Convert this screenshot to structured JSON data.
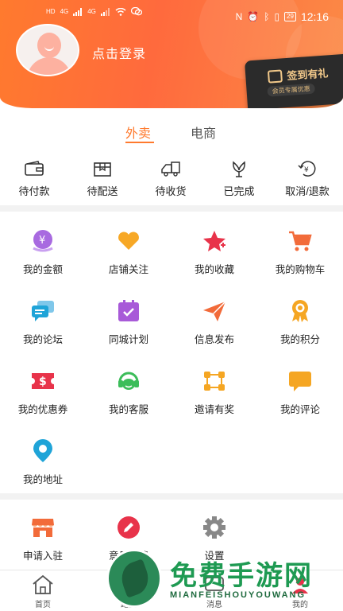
{
  "status_bar": {
    "left_indicators": [
      "HD",
      "4G",
      "4G"
    ],
    "time": "12:16",
    "battery": "29"
  },
  "header": {
    "login_text": "点击登录",
    "signin_label": "签到有礼",
    "signin_sub": "会员专属优惠"
  },
  "tabs": [
    {
      "label": "外卖",
      "active": true
    },
    {
      "label": "电商",
      "active": false
    }
  ],
  "orders": [
    {
      "label": "待付款",
      "icon": "wallet-icon"
    },
    {
      "label": "待配送",
      "icon": "package-icon"
    },
    {
      "label": "待收货",
      "icon": "truck-icon"
    },
    {
      "label": "已完成",
      "icon": "flower-icon"
    },
    {
      "label": "取消/退款",
      "icon": "refund-icon"
    }
  ],
  "services": [
    {
      "label": "我的金额",
      "icon": "money-icon",
      "color": "#9b59d6"
    },
    {
      "label": "店铺关注",
      "icon": "heart-icon",
      "color": "#f5a623"
    },
    {
      "label": "我的收藏",
      "icon": "star-icon",
      "color": "#e8334a"
    },
    {
      "label": "我的购物车",
      "icon": "cart-icon",
      "color": "#f26b3a"
    },
    {
      "label": "我的论坛",
      "icon": "forum-icon",
      "color": "#1fa4d8"
    },
    {
      "label": "同城计划",
      "icon": "calendar-icon",
      "color": "#a85ad8"
    },
    {
      "label": "信息发布",
      "icon": "send-icon",
      "color": "#f26b3a"
    },
    {
      "label": "我的积分",
      "icon": "medal-icon",
      "color": "#f5a623"
    },
    {
      "label": "我的优惠券",
      "icon": "coupon-icon",
      "color": "#e8334a"
    },
    {
      "label": "我的客服",
      "icon": "headset-icon",
      "color": "#3cbd5a"
    },
    {
      "label": "邀请有奖",
      "icon": "share-icon",
      "color": "#f5a623"
    },
    {
      "label": "我的评论",
      "icon": "comment-icon",
      "color": "#f5a623"
    },
    {
      "label": "我的地址",
      "icon": "location-icon",
      "color": "#1fa4d8"
    }
  ],
  "tools": [
    {
      "label": "申请入驻",
      "icon": "store-icon",
      "color": "#f26b3a"
    },
    {
      "label": "意见反馈",
      "icon": "edit-icon",
      "color": "#e8334a"
    },
    {
      "label": "设置",
      "icon": "gear-icon",
      "color": "#888888"
    }
  ],
  "bottom_nav": [
    {
      "label": "首页",
      "icon": "home-icon"
    },
    {
      "label": "跑腿",
      "icon": "errand-icon"
    },
    {
      "label": "消息",
      "icon": "message-icon"
    },
    {
      "label": "我的",
      "icon": "profile-icon"
    }
  ],
  "watermark": {
    "title": "免费手游网",
    "subtitle": "MIANFEISHOUYOUWANG"
  },
  "colors": {
    "accent": "#ff7a2e",
    "header_start": "#ff7a2e",
    "header_end": "#fb8a46"
  }
}
